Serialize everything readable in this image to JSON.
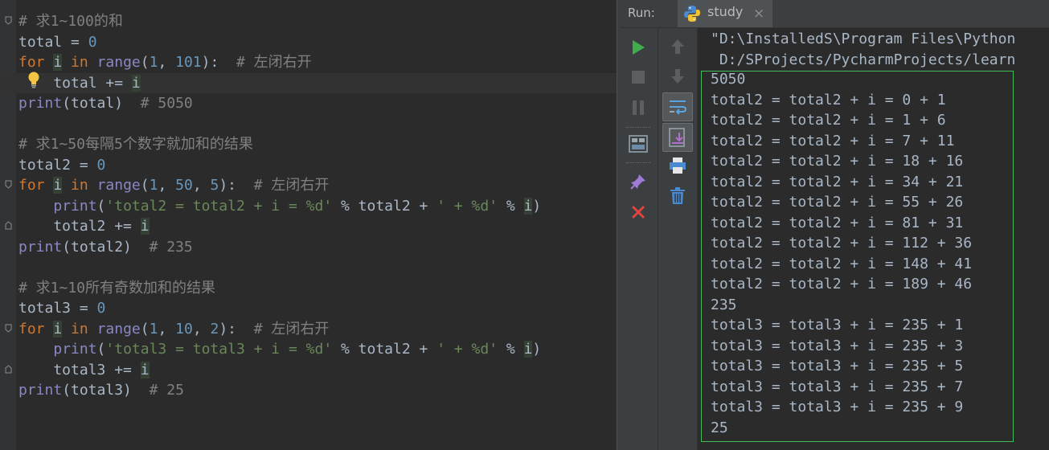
{
  "editor": {
    "lines": [
      {
        "t": [
          [
            "cm",
            "# 求1~100的和"
          ]
        ]
      },
      {
        "t": [
          [
            "p",
            "total = "
          ],
          [
            "num",
            "0"
          ]
        ]
      },
      {
        "t": [
          [
            "kw",
            "for "
          ],
          [
            "var",
            "i"
          ],
          [
            "kw",
            " in "
          ],
          [
            "fn",
            "range"
          ],
          [
            "p",
            "("
          ],
          [
            "num",
            "1"
          ],
          [
            "p",
            ", "
          ],
          [
            "num",
            "101"
          ],
          [
            "p",
            "):  "
          ],
          [
            "cm",
            "# 左闭右开"
          ]
        ]
      },
      {
        "t": [
          [
            "p",
            "    total += "
          ],
          [
            "var",
            "i"
          ]
        ],
        "current": true
      },
      {
        "t": [
          [
            "fn",
            "print"
          ],
          [
            "p",
            "(total)  "
          ],
          [
            "cm",
            "# 5050"
          ]
        ]
      },
      {
        "t": []
      },
      {
        "t": [
          [
            "cm",
            "# 求1~50每隔5个数字就加和的结果"
          ]
        ]
      },
      {
        "t": [
          [
            "p",
            "total2 = "
          ],
          [
            "num",
            "0"
          ]
        ]
      },
      {
        "t": [
          [
            "kw",
            "for "
          ],
          [
            "var",
            "i"
          ],
          [
            "kw",
            " in "
          ],
          [
            "fn",
            "range"
          ],
          [
            "p",
            "("
          ],
          [
            "num",
            "1"
          ],
          [
            "p",
            ", "
          ],
          [
            "num",
            "50"
          ],
          [
            "p",
            ", "
          ],
          [
            "num",
            "5"
          ],
          [
            "p",
            "):  "
          ],
          [
            "cm",
            "# 左闭右开"
          ]
        ]
      },
      {
        "t": [
          [
            "p",
            "    "
          ],
          [
            "fn",
            "print"
          ],
          [
            "p",
            "("
          ],
          [
            "str",
            "'total2 = total2 + i = %d'"
          ],
          [
            "p",
            " % total2 + "
          ],
          [
            "str",
            "' + %d'"
          ],
          [
            "p",
            " % "
          ],
          [
            "var",
            "i"
          ],
          [
            "p",
            ")"
          ]
        ]
      },
      {
        "t": [
          [
            "p",
            "    total2 += "
          ],
          [
            "var",
            "i"
          ]
        ]
      },
      {
        "t": [
          [
            "fn",
            "print"
          ],
          [
            "p",
            "(total2)  "
          ],
          [
            "cm",
            "# 235"
          ]
        ]
      },
      {
        "t": []
      },
      {
        "t": [
          [
            "cm",
            "# 求1~10所有奇数加和的结果"
          ]
        ]
      },
      {
        "t": [
          [
            "p",
            "total3 = "
          ],
          [
            "num",
            "0"
          ]
        ]
      },
      {
        "t": [
          [
            "kw",
            "for "
          ],
          [
            "var",
            "i"
          ],
          [
            "kw",
            " in "
          ],
          [
            "fn",
            "range"
          ],
          [
            "p",
            "("
          ],
          [
            "num",
            "1"
          ],
          [
            "p",
            ", "
          ],
          [
            "num",
            "10"
          ],
          [
            "p",
            ", "
          ],
          [
            "num",
            "2"
          ],
          [
            "p",
            "):  "
          ],
          [
            "cm",
            "# 左闭右开"
          ]
        ]
      },
      {
        "t": [
          [
            "p",
            "    "
          ],
          [
            "fn",
            "print"
          ],
          [
            "p",
            "("
          ],
          [
            "str",
            "'total3 = total3 + i = %d'"
          ],
          [
            "p",
            " % total2 + "
          ],
          [
            "str",
            "' + %d'"
          ],
          [
            "p",
            " % "
          ],
          [
            "var",
            "i"
          ],
          [
            "p",
            ")"
          ]
        ]
      },
      {
        "t": [
          [
            "p",
            "    total3 += "
          ],
          [
            "var",
            "i"
          ]
        ]
      },
      {
        "t": [
          [
            "fn",
            "print"
          ],
          [
            "p",
            "(total3)  "
          ],
          [
            "cm",
            "# 25"
          ]
        ]
      }
    ]
  },
  "run": {
    "label": "Run:",
    "tab_label": "study",
    "close_glyph": "×"
  },
  "console": {
    "lines": [
      "\"D:\\InstalledS\\Program Files\\Python",
      " D:/SProjects/PycharmProjects/learn",
      "5050",
      "total2 = total2 + i = 0 + 1",
      "total2 = total2 + i = 1 + 6",
      "total2 = total2 + i = 7 + 11",
      "total2 = total2 + i = 18 + 16",
      "total2 = total2 + i = 34 + 21",
      "total2 = total2 + i = 55 + 26",
      "total2 = total2 + i = 81 + 31",
      "total2 = total2 + i = 112 + 36",
      "total2 = total2 + i = 148 + 41",
      "total2 = total2 + i = 189 + 46",
      "235",
      "total3 = total3 + i = 235 + 1",
      "total3 = total3 + i = 235 + 3",
      "total3 = total3 + i = 235 + 5",
      "total3 = total3 + i = 235 + 7",
      "total3 = total3 + i = 235 + 9",
      "25"
    ]
  },
  "icons": [
    "rerun-icon",
    "stop-icon",
    "pause-icon",
    "layout-icon",
    "pin-icon",
    "close-run-icon",
    "up-arrow-icon",
    "down-arrow-icon",
    "soft-wrap-icon",
    "scroll-to-end-icon",
    "print-icon",
    "trash-icon",
    "python-icon",
    "lightbulb-icon",
    "fold-icon"
  ],
  "colors": {
    "editor_bg": "#2b2b2b",
    "panel_bg": "#3c3f41",
    "keyword": "#cc7832",
    "builtin": "#8888c6",
    "number": "#6897bb",
    "string": "#6a8759",
    "comment": "#808080",
    "output_border": "#3fbd58"
  }
}
